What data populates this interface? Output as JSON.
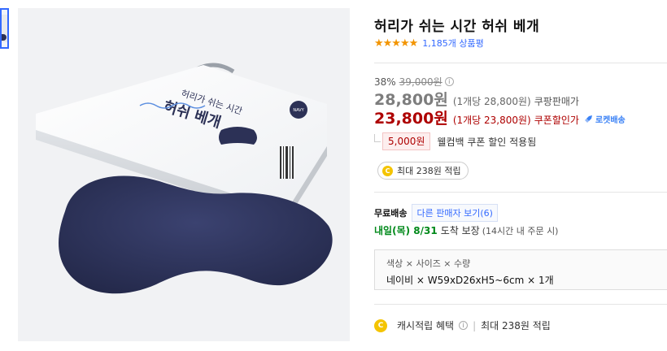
{
  "product": {
    "title": "허리가 쉬는 시간 허쉬 베개",
    "stars": "★★★★★",
    "review_count": "1,185개 상품평"
  },
  "pricing": {
    "discount_rate": "38%",
    "original_price": "39,000원",
    "sale_price": "28,800원",
    "sale_unit": "(1개당 28,800원)",
    "sale_label": "쿠팡판매가",
    "coupon_price": "23,800원",
    "coupon_unit": "(1개당 23,800원)",
    "coupon_label": "쿠폰할인가",
    "rocket_label": "로켓배송"
  },
  "coupon": {
    "amount": "5,000원",
    "text": "웰컴백 쿠폰 할인 적용됨"
  },
  "cashback": {
    "coin": "C",
    "pill_text": "최대 238원 적립",
    "row_label": "캐시적립 혜택",
    "row_value": "최대 238원 적립"
  },
  "shipping": {
    "label": "무료배송",
    "other_sellers": "다른 판매자 보기(6)",
    "delivery_date": "내일(목) 8/31",
    "delivery_rest": "도착 보장",
    "delivery_note": "(14시간 내 주문 시)"
  },
  "options": {
    "names": "색상 × 사이즈 × 수량",
    "values": "네이비 × W59xD26xH5~6cm × 1개"
  },
  "image": {
    "box_text_top": "허리가 쉬는 시간",
    "box_text_main": "허쉬 베개",
    "box_badge": "NAVY"
  },
  "colors": {
    "accent_blue": "#346aff",
    "sale_red": "#ae0000",
    "delivery_green": "#00891a",
    "star_orange": "#f29400",
    "pillow_navy": "#2c3156"
  }
}
